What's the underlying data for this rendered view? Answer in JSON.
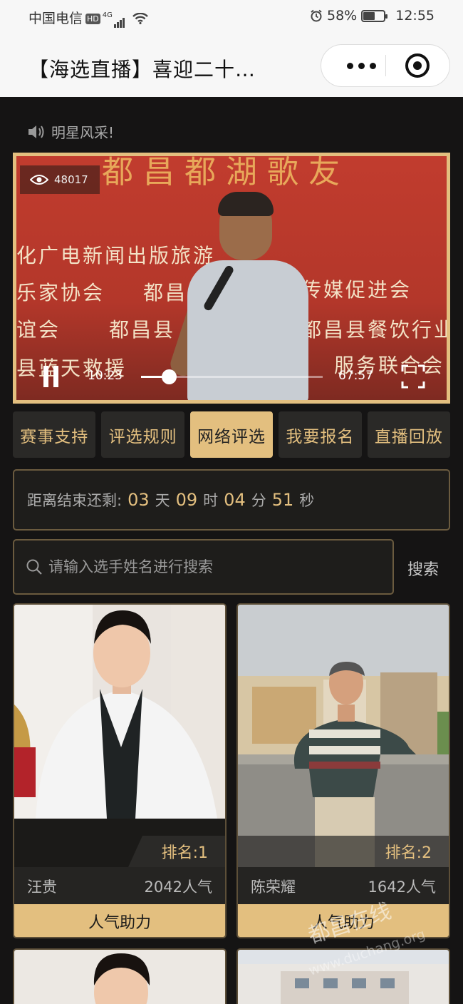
{
  "status_bar": {
    "carrier": "中国电信",
    "hd": "HD",
    "network": "4G",
    "battery": "58%",
    "battery_level": 0.58,
    "time": "12:55"
  },
  "header": {
    "title": "【海选直播】喜迎二十…"
  },
  "notice": {
    "text": "明星风采!"
  },
  "video": {
    "views": "48017",
    "current_time": "10:23",
    "total_time": "67:57",
    "progress": 0.153,
    "banner_lines": [
      "化广电新闻出版旅游",
      "乐家协会",
      "都昌",
      "传媒促进会",
      "谊会",
      "都昌县",
      "都昌县餐饮行业",
      "县蓝天救援",
      "服务联合会",
      "都昌都湖歌友"
    ]
  },
  "tabs": [
    {
      "label": "赛事支持",
      "active": false
    },
    {
      "label": "评选规则",
      "active": false
    },
    {
      "label": "网络评选",
      "active": true
    },
    {
      "label": "我要报名",
      "active": false
    },
    {
      "label": "直播回放",
      "active": false
    }
  ],
  "countdown": {
    "label": "距离结束还剩:",
    "days": "03",
    "days_unit": "天",
    "hours": "09",
    "hours_unit": "时",
    "minutes": "04",
    "minutes_unit": "分",
    "seconds": "51",
    "seconds_unit": "秒"
  },
  "search": {
    "placeholder": "请输入选手姓名进行搜索",
    "button": "搜索"
  },
  "contestants": [
    {
      "rank_label": "排名:1",
      "name": "汪贵",
      "popularity": "2042人气",
      "boost": "人气助力"
    },
    {
      "rank_label": "排名:2",
      "name": "陈荣耀",
      "popularity": "1642人气",
      "boost": "人气助力"
    }
  ],
  "watermark": {
    "line1": "都昌在线",
    "line2": "www.duchang.org"
  },
  "colors": {
    "gold": "#e3bf7f",
    "background": "#151414",
    "tab_bg": "#2a2927"
  }
}
